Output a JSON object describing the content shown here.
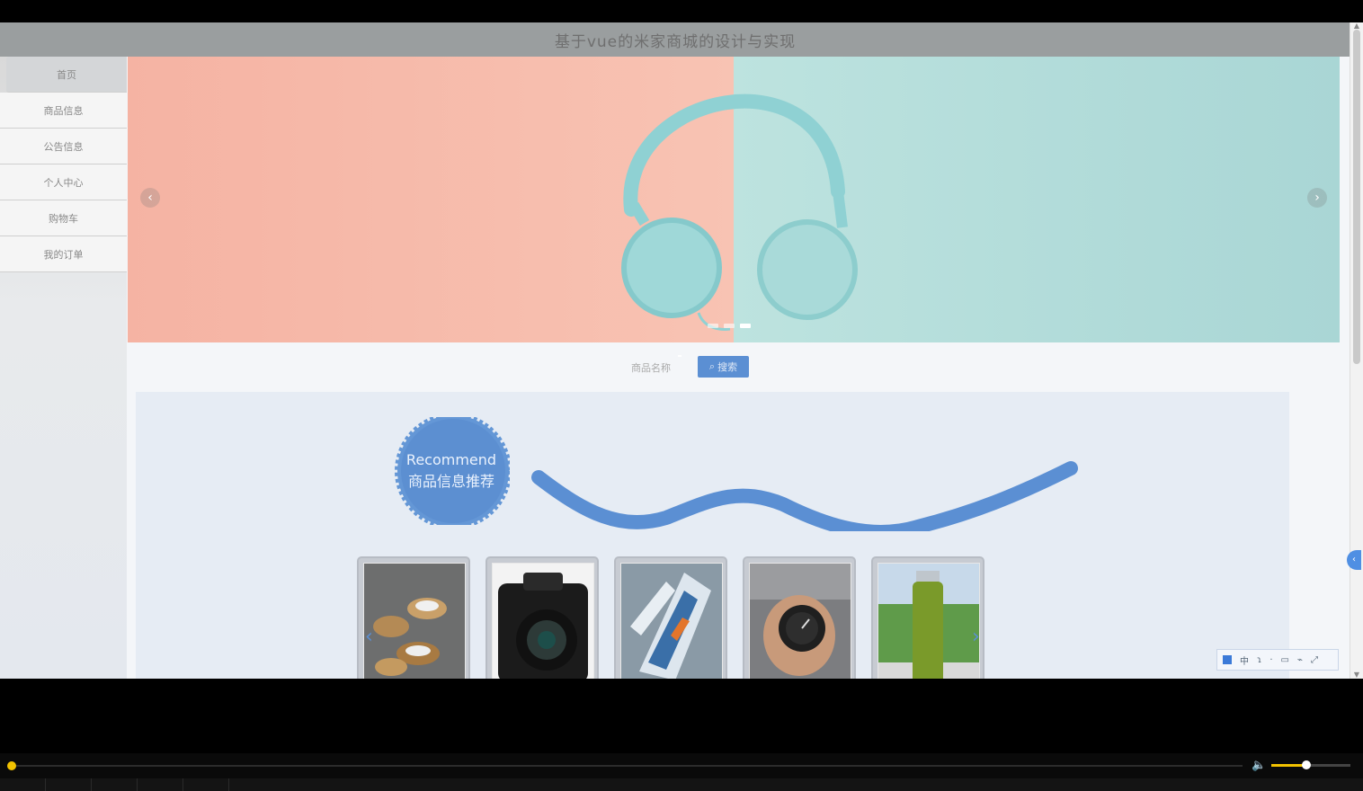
{
  "app": {
    "title": "基于vue的米家商城的设计与实现"
  },
  "sidebar": {
    "items": [
      {
        "label": "首页",
        "active": true
      },
      {
        "label": "商品信息",
        "active": false
      },
      {
        "label": "公告信息",
        "active": false
      },
      {
        "label": "个人中心",
        "active": false
      },
      {
        "label": "购物车",
        "active": false
      },
      {
        "label": "我的订单",
        "active": false
      }
    ]
  },
  "banner": {
    "prev_glyph": "‹",
    "next_glyph": "›",
    "slide_count": 3,
    "active_slide": 3
  },
  "search": {
    "label": "商品名称",
    "button_label": "搜索",
    "button_icon": "search-icon",
    "accent": "#5b8fd3"
  },
  "recommend": {
    "badge_en": "Recommend",
    "badge_zh": "商品信息推荐",
    "prev_glyph": "‹",
    "next_glyph": "›",
    "products": [
      {
        "name": "food-bowls-image"
      },
      {
        "name": "camera-image"
      },
      {
        "name": "sneakers-image"
      },
      {
        "name": "watch-image"
      },
      {
        "name": "bottle-image"
      }
    ]
  },
  "ime": {
    "items": [
      "中",
      "ɿ",
      "·",
      "▭",
      "⌁",
      "⤢"
    ]
  },
  "player": {
    "progress": 0,
    "volume": 0.45,
    "accent": "#f2c200"
  }
}
